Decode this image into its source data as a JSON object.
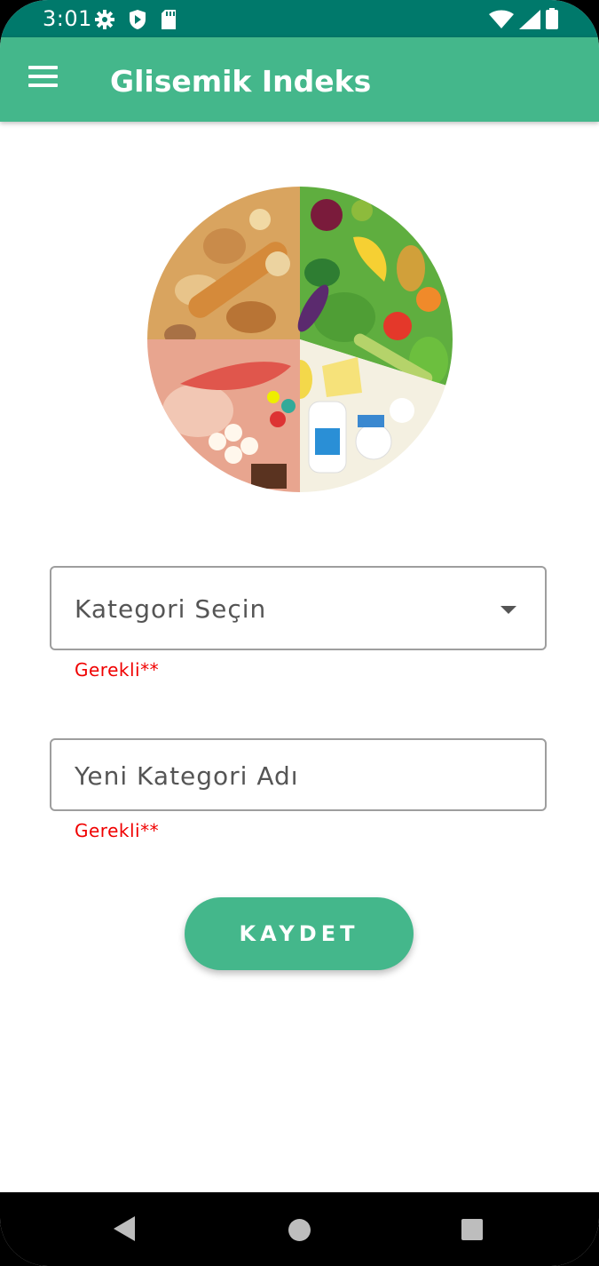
{
  "status_bar": {
    "time": "3:01",
    "left_icons": [
      "gear-icon",
      "shield-play-icon",
      "sd-card-icon"
    ],
    "right_icons": [
      "wifi-icon",
      "signal-icon",
      "battery-icon"
    ],
    "color": "#00796b"
  },
  "app_bar": {
    "title": "Glisemik Indeks",
    "menu_icon": "hamburger-menu-icon",
    "color": "#44b78b"
  },
  "hero": {
    "image": "food-groups-plate-illustration"
  },
  "form": {
    "category_dropdown": {
      "selected": "Kategori Seçin",
      "error": "Gerekli**"
    },
    "new_category_input": {
      "placeholder": "Yeni Kategori Adı",
      "error": "Gerekli**"
    },
    "save_button": "KAYDET"
  },
  "nav_bar": {
    "icons": [
      "back-icon",
      "home-icon",
      "recents-icon"
    ]
  }
}
